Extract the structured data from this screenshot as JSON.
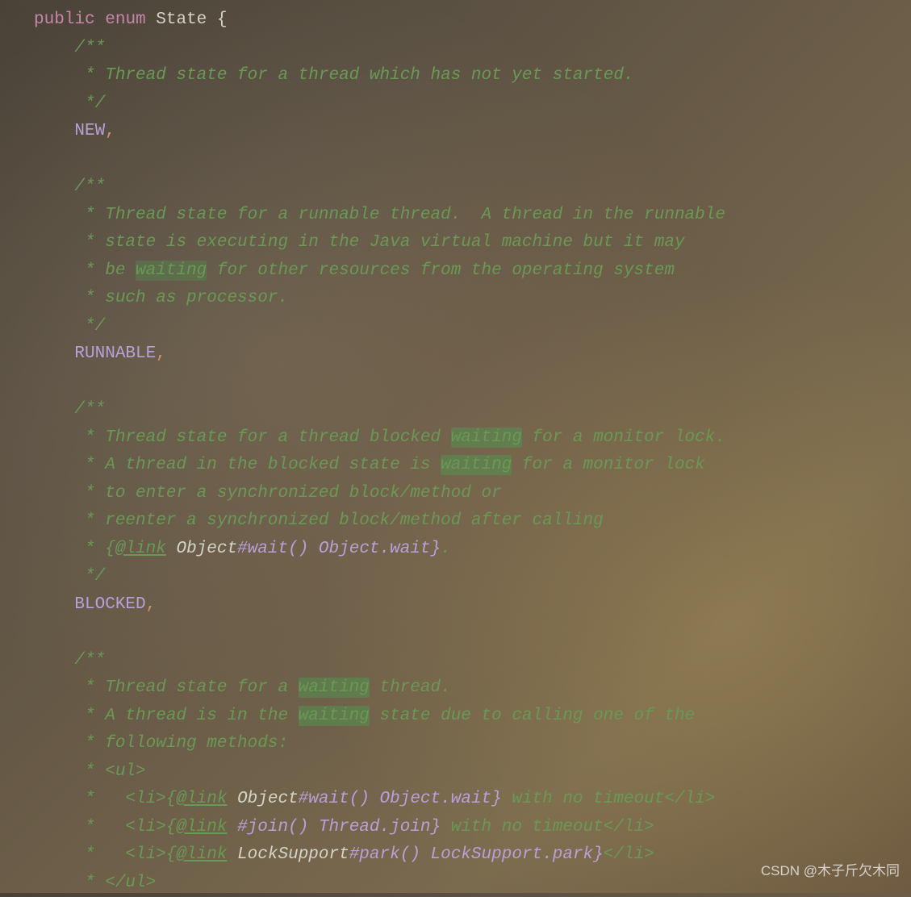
{
  "code": {
    "decl_public": "public",
    "decl_enum": "enum",
    "decl_name": "State",
    "decl_brace": "{",
    "new_doc_open": "/**",
    "new_doc_l1": " * Thread state for a thread which has not yet started.",
    "new_doc_close": " */",
    "new_val": "NEW",
    "comma": ",",
    "run_doc_open": "/**",
    "run_doc_l1": " * Thread state for a runnable thread.  A thread in the runnable",
    "run_doc_l2": " * state is executing in the Java virtual machine but it may",
    "run_doc_l3a": " * be ",
    "run_doc_l3_hl": "waiting",
    "run_doc_l3b": " for other resources from the operating system",
    "run_doc_l4": " * such as processor.",
    "run_doc_close": " */",
    "run_val": "RUNNABLE",
    "blk_doc_open": "/**",
    "blk_doc_l1a": " * Thread state for a thread blocked ",
    "blk_doc_l1_hl": "waiting",
    "blk_doc_l1b": " for a monitor lock.",
    "blk_doc_l2a": " * A thread in the blocked state is ",
    "blk_doc_l2_hl": "waiting",
    "blk_doc_l2b": " for a monitor lock",
    "blk_doc_l3": " * to enter a synchronized block/method or",
    "blk_doc_l4": " * reenter a synchronized block/method after calling",
    "blk_doc_l5a": " * {",
    "blk_doc_l5_link": "@link",
    "blk_doc_l5_sp": " ",
    "blk_doc_l5_type": "Object",
    "blk_doc_l5_method": "#wait() Object.wait}",
    "blk_doc_l5b": ".",
    "blk_doc_close": " */",
    "blk_val": "BLOCKED",
    "wait_doc_open": "/**",
    "wait_doc_l1a": " * Thread state for a ",
    "wait_doc_l1_hl": "waiting",
    "wait_doc_l1b": " thread.",
    "wait_doc_l2a": " * A thread is in the ",
    "wait_doc_l2_hl": "waiting",
    "wait_doc_l2b": " state due to calling one of the",
    "wait_doc_l3": " * following methods:",
    "wait_doc_l4": " * <ul>",
    "wait_doc_l5a": " *   <li>{",
    "wait_doc_l5_link": "@link",
    "wait_doc_l5_sp": " ",
    "wait_doc_l5_type": "Object",
    "wait_doc_l5_method": "#wait() Object.wait}",
    "wait_doc_l5b": " with no timeout",
    "wait_doc_l5c": "</li>",
    "wait_doc_l6a": " *   <li>{",
    "wait_doc_l6_link": "@link",
    "wait_doc_l6_sp": " ",
    "wait_doc_l6_method": "#join() Thread.join}",
    "wait_doc_l6b": " with no timeout",
    "wait_doc_l6c": "</li>",
    "wait_doc_l7a": " *   <li>{",
    "wait_doc_l7_link": "@link",
    "wait_doc_l7_sp": " ",
    "wait_doc_l7_type": "LockSupport",
    "wait_doc_l7_method": "#park() LockSupport.park}",
    "wait_doc_l7c": "</li>",
    "wait_doc_l8": " * </ul>"
  },
  "watermark": "CSDN @木子斤欠木同"
}
